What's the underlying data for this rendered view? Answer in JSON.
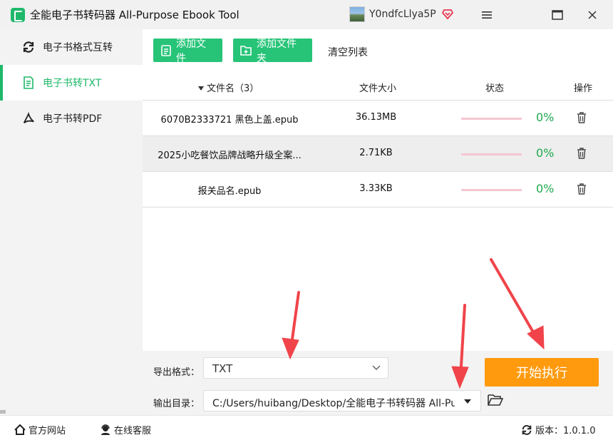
{
  "window": {
    "title": "全能电子书转码器 All-Purpose Ebook Tool",
    "username": "Y0ndfcLlya5P"
  },
  "sidebar": {
    "items": [
      {
        "label": "电子书格式互转",
        "icon": "refresh-icon"
      },
      {
        "label": "电子书转TXT",
        "icon": "document-icon",
        "active": true
      },
      {
        "label": "电子书转PDF",
        "icon": "pdf-icon"
      }
    ]
  },
  "toolbar": {
    "add_file_label": "添加文件",
    "add_folder_label": "添加文件夹",
    "clear_list_label": "清空列表"
  },
  "table": {
    "headers": {
      "name": "文件名（3）",
      "size": "文件大小",
      "status": "状态",
      "actions": "操作"
    },
    "rows": [
      {
        "name": "6070B2333721 黑色上盖.epub",
        "size": "36.13MB",
        "progress": 0,
        "percent": "0%"
      },
      {
        "name": "2025小吃餐饮品牌战略升级全案...",
        "size": "2.71KB",
        "progress": 0,
        "percent": "0%",
        "selected": true
      },
      {
        "name": "报关品名.epub",
        "size": "3.33KB",
        "progress": 0,
        "percent": "0%"
      }
    ]
  },
  "settings": {
    "format_label": "导出格式：",
    "format_value": "TXT",
    "output_label": "输出目录：",
    "output_value": "C:/Users/huibang/Desktop/全能电子书转码器 All-Purpose Ebook Tool",
    "start_label": "开始执行"
  },
  "statusbar": {
    "website_label": "官方网站",
    "support_label": "在线客服",
    "version_label": "版本：1.0.1.0"
  },
  "colors": {
    "accent": "#27c478",
    "start": "#ff9a0e",
    "arrow": "#f0444a",
    "progress_track": "#f5c6d2"
  }
}
